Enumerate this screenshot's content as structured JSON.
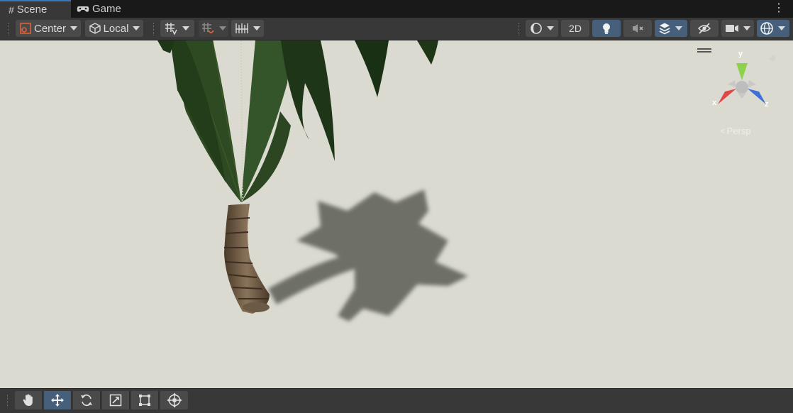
{
  "tabs": [
    {
      "label": "Scene",
      "icon": "grid-hash-icon"
    },
    {
      "label": "Game",
      "icon": "gamepad-icon"
    }
  ],
  "toolbar": {
    "pivot_label": "Center",
    "space_label": "Local",
    "mode_2d_label": "2D"
  },
  "gizmo": {
    "axis_x": "x",
    "axis_y": "y",
    "axis_z": "z",
    "projection_label": "Persp"
  },
  "colors": {
    "accent_active": "#46607c",
    "axis_x": "#e04848",
    "axis_y": "#8ed14a",
    "axis_z": "#3f6fd8",
    "viewport_bg": "#dadad0"
  },
  "bottom_tools": [
    "hand-tool",
    "move-tool",
    "rotate-tool",
    "scale-tool",
    "rect-tool",
    "transform-tool"
  ]
}
